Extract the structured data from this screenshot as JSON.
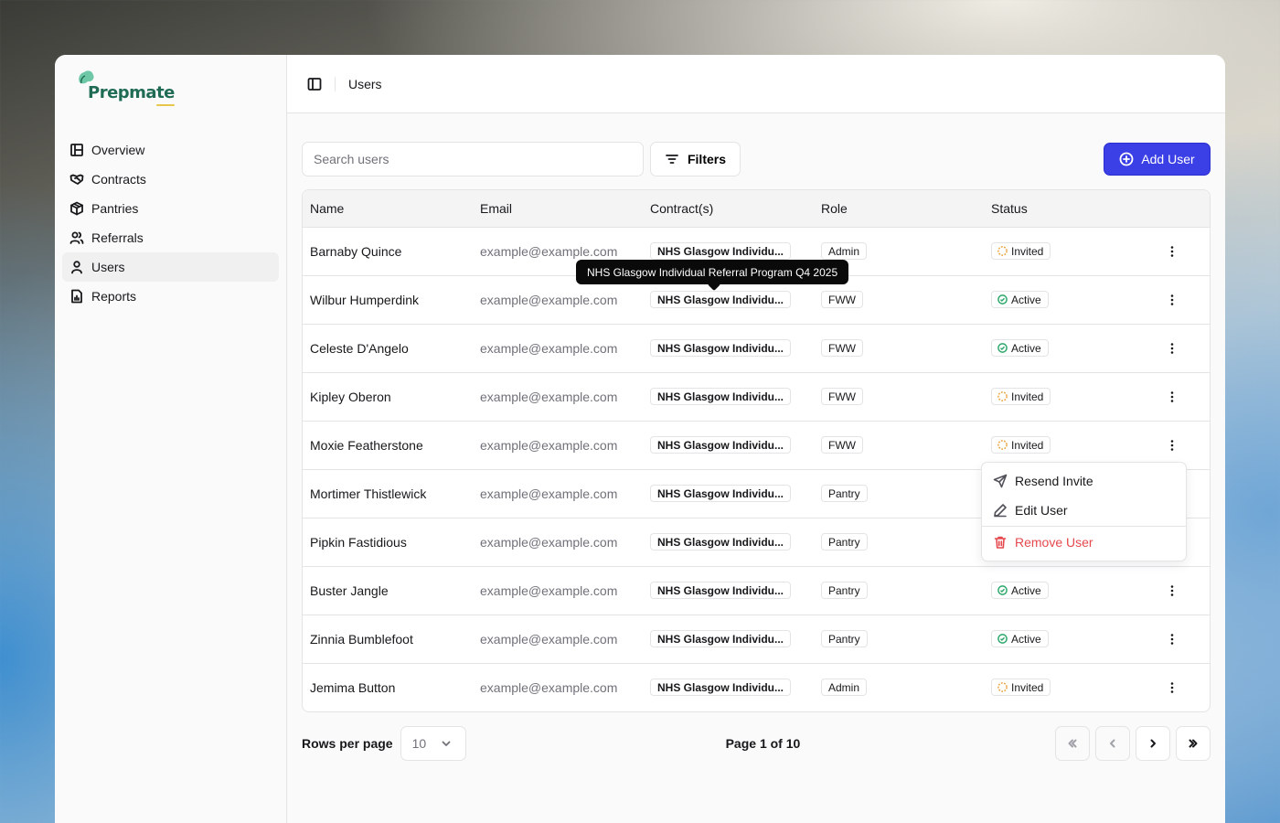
{
  "app": {
    "name": "Prepmate"
  },
  "sidebar": {
    "items": [
      {
        "label": "Overview",
        "icon": "layout-icon"
      },
      {
        "label": "Contracts",
        "icon": "handshake-icon"
      },
      {
        "label": "Pantries",
        "icon": "package-icon"
      },
      {
        "label": "Referrals",
        "icon": "users-icon"
      },
      {
        "label": "Users",
        "icon": "user-icon",
        "active": true
      },
      {
        "label": "Reports",
        "icon": "report-icon"
      }
    ]
  },
  "header": {
    "breadcrumb": "Users"
  },
  "toolbar": {
    "search_placeholder": "Search users",
    "search_value": "",
    "filters_label": "Filters",
    "add_label": "Add User",
    "accent_color": "#3b3fe6"
  },
  "table": {
    "columns": [
      "Name",
      "Email",
      "Contract(s)",
      "Role",
      "Status"
    ],
    "rows": [
      {
        "name": "Barnaby Quince",
        "email": "example@example.com",
        "contract": "NHS Glasgow Individu...",
        "role": "Admin",
        "status": "Invited"
      },
      {
        "name": "Wilbur Humperdink",
        "email": "example@example.com",
        "contract": "NHS Glasgow Individu...",
        "role": "FWW",
        "status": "Active"
      },
      {
        "name": "Celeste D'Angelo",
        "email": "example@example.com",
        "contract": "NHS Glasgow Individu...",
        "role": "FWW",
        "status": "Active"
      },
      {
        "name": "Kipley Oberon",
        "email": "example@example.com",
        "contract": "NHS Glasgow Individu...",
        "role": "FWW",
        "status": "Invited"
      },
      {
        "name": "Moxie Featherstone",
        "email": "example@example.com",
        "contract": "NHS Glasgow Individu...",
        "role": "FWW",
        "status": "Invited"
      },
      {
        "name": "Mortimer Thistlewick",
        "email": "example@example.com",
        "contract": "NHS Glasgow Individu...",
        "role": "Pantry",
        "status": ""
      },
      {
        "name": "Pipkin Fastidious",
        "email": "example@example.com",
        "contract": "NHS Glasgow Individu...",
        "role": "Pantry",
        "status": ""
      },
      {
        "name": "Buster Jangle",
        "email": "example@example.com",
        "contract": "NHS Glasgow Individu...",
        "role": "Pantry",
        "status": "Active"
      },
      {
        "name": "Zinnia Bumblefoot",
        "email": "example@example.com",
        "contract": "NHS Glasgow Individu...",
        "role": "Pantry",
        "status": "Active"
      },
      {
        "name": "Jemima Button",
        "email": "example@example.com",
        "contract": "NHS Glasgow Individu...",
        "role": "Admin",
        "status": "Invited"
      }
    ]
  },
  "tooltip": {
    "text": "NHS Glasgow Individual Referral Program Q4 2025"
  },
  "row_menu": {
    "items": [
      {
        "label": "Resend Invite",
        "icon": "send-icon"
      },
      {
        "label": "Edit User",
        "icon": "pencil-icon"
      },
      {
        "label": "Remove User",
        "icon": "trash-icon",
        "danger": true
      }
    ]
  },
  "pagination": {
    "rows_label": "Rows per page",
    "rows_value": "10",
    "page_info": "Page 1 of 10"
  },
  "colors": {
    "invited": "#e8a23a",
    "active": "#2ea86b",
    "danger": "#e5484d"
  }
}
